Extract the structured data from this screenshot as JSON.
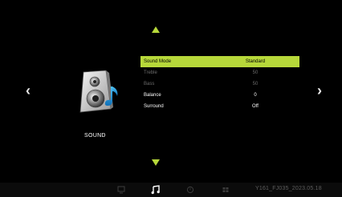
{
  "section": {
    "title": "SOUND",
    "icon": "speaker-music-icon"
  },
  "navigation": {
    "up_icon": "triangle-up-icon",
    "down_icon": "triangle-down-icon",
    "left_glyph": "‹",
    "right_glyph": "›"
  },
  "menu": {
    "items": [
      {
        "label": "Sound Mode",
        "value": "Standard",
        "state": "selected"
      },
      {
        "label": "Treble",
        "value": "50",
        "state": "disabled"
      },
      {
        "label": "Bass",
        "value": "50",
        "state": "disabled"
      },
      {
        "label": "Balance",
        "value": "0",
        "state": "enabled"
      },
      {
        "label": "Surround",
        "value": "Off",
        "state": "enabled"
      }
    ]
  },
  "bottom_bar": {
    "tabs": [
      {
        "name": "picture-tab",
        "icon": "monitor-icon",
        "active": false
      },
      {
        "name": "sound-tab",
        "icon": "music-note-icon",
        "active": true
      },
      {
        "name": "time-tab",
        "icon": "clock-icon",
        "active": false
      },
      {
        "name": "setup-tab",
        "icon": "grid-icon",
        "active": false
      }
    ],
    "build_info": "Y161_FJ035_2023.05.18"
  },
  "colors": {
    "accent": "#b7d83a",
    "background": "#000000",
    "disabled_text": "#6c6c6c",
    "build_text": "#5d5d5d"
  }
}
